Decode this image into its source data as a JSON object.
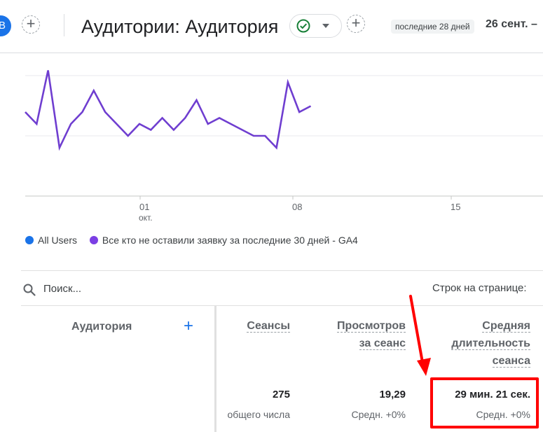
{
  "header": {
    "avatar_letter": "В",
    "add_comparison": "+",
    "title": "Аудитории: Аудитория",
    "add_report": "+",
    "period_label": "последние 28 дней",
    "date_range": "26 сент. –"
  },
  "chart_data": {
    "type": "line",
    "x_tick_labels": [
      "01\nокт.",
      "08",
      "15"
    ],
    "x_ticks": [
      {
        "day": "01",
        "month": "окт."
      },
      {
        "day": "08",
        "month": ""
      },
      {
        "day": "15",
        "month": ""
      }
    ],
    "series": [
      {
        "name": "Все кто не оставили заявку за последние 30 дней - GA4",
        "color": "#6f3ed0",
        "values": [
          3.0,
          2.0,
          6.5,
          0.0,
          2.0,
          3.0,
          4.8,
          3.0,
          2.0,
          1.0,
          2.0,
          1.5,
          2.5,
          1.5,
          2.5,
          4.0,
          2.0,
          2.5,
          2.0,
          1.5,
          1.0,
          1.0,
          0.0,
          5.5,
          3.0,
          3.5
        ]
      }
    ]
  },
  "legend": [
    {
      "label": "All Users",
      "color": "#1a73e8"
    },
    {
      "label": "Все кто не оставили заявку за последние 30 дней - GA4",
      "color": "#7b3fe4"
    }
  ],
  "search": {
    "placeholder": "Поиск..."
  },
  "pagination": {
    "rows_per_page_label": "Строк на странице:"
  },
  "table": {
    "dimension_header": "Аудитория",
    "add_dimension": "+",
    "columns": [
      {
        "line1": "Сеансы",
        "line2": "",
        "line3": "",
        "value": "275",
        "sub": "общего числа"
      },
      {
        "line1": "Просмотров",
        "line2": "за сеанс",
        "line3": "",
        "value": "19,29",
        "sub": "Средн. +0%"
      },
      {
        "line1": "Средняя",
        "line2": "длительность",
        "line3": "сеанса",
        "value": "29 мин. 21 сек.",
        "sub": "Средн. +0%"
      }
    ]
  },
  "annotation": {
    "color": "#ff0000"
  }
}
